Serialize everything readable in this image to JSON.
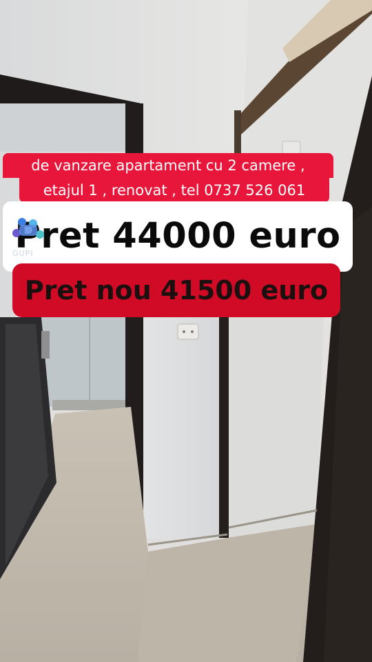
{
  "overlay": {
    "caption_line1": "de vanzare apartament cu 2 camere ,",
    "caption_line2": "etajul 1 , renovat , tel 0737 526 061",
    "old_price": "Pret 44000 euro",
    "new_price": "Pret nou 41500 euro",
    "watermark_text": "GUPI"
  },
  "colors": {
    "caption_bg": "#e8163a",
    "new_price_bg": "#d10a26",
    "old_price_bg": "#ffffff"
  }
}
